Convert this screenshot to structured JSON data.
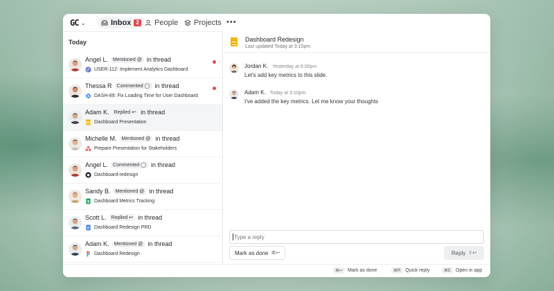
{
  "nav": {
    "logo": "GC",
    "inbox_label": "Inbox",
    "inbox_count": "2",
    "people_label": "People",
    "projects_label": "Projects",
    "more_label": "•••"
  },
  "list": {
    "section_label": "Today",
    "in_thread": "in thread",
    "items": [
      {
        "name": "Angel L.",
        "action": "Mentioned",
        "action_glyph": "@",
        "subject": "USER-112: Implement Analytics Dashboard",
        "source_icon": "linear-icon",
        "unread": true
      },
      {
        "name": "Thessa R",
        "action": "Commented",
        "action_glyph": "◯",
        "subject": "DASH-89: Fix Loading Time for User Dashboard",
        "source_icon": "jira-icon",
        "unread": true
      },
      {
        "name": "Adam K.",
        "action": "Replied",
        "action_glyph": "↩",
        "subject": "Dashboard Presentation",
        "source_icon": "google-slides-icon",
        "unread": false
      },
      {
        "name": "Michelle M.",
        "action": "Mentioned",
        "action_glyph": "@",
        "subject": "Prepare Presentation for Stakeholders",
        "source_icon": "asana-icon",
        "unread": false
      },
      {
        "name": "Angel L.",
        "action": "Commented",
        "action_glyph": "◯",
        "subject": "Dashboard-redesign",
        "source_icon": "github-icon",
        "unread": false
      },
      {
        "name": "Sandy B.",
        "action": "Mentioned",
        "action_glyph": "@",
        "subject": "Dashboard Metrics Tracking",
        "source_icon": "google-sheets-icon",
        "unread": false
      },
      {
        "name": "Scott L.",
        "action": "Replied",
        "action_glyph": "↩",
        "subject": "Dashboard Redesign PRD",
        "source_icon": "google-docs-icon",
        "unread": false
      },
      {
        "name": "Adam K.",
        "action": "Mentioned",
        "action_glyph": "@",
        "subject": "Dashboard Redesign",
        "source_icon": "figma-icon",
        "unread": false
      }
    ]
  },
  "detail": {
    "title": "Dashboard Redesign",
    "subtitle": "Last updated Today at 3:10pm",
    "messages": [
      {
        "author": "Jordan K.",
        "time": "Yesterday at 6:00pm",
        "body": "Let's add key metrics to this slide."
      },
      {
        "author": "Adam K.",
        "time": "Today at 3:10pm",
        "body": "I've added the key metrics. Let me know your thoughts"
      }
    ],
    "reply_placeholder": "Type a reply",
    "mark_done_label": "Mark as done",
    "mark_done_kbd": "⌘↩",
    "reply_label": "Reply",
    "reply_kbd": "⇧↩"
  },
  "footer": {
    "hints": [
      {
        "key": "⌘↩",
        "label": "Mark as done"
      },
      {
        "key": "⌘R",
        "label": "Quick reply"
      },
      {
        "key": "⌘E",
        "label": "Open in app"
      }
    ]
  },
  "colors": {
    "accent_red": "#e5484d",
    "file_yellow": "#f5b400"
  }
}
